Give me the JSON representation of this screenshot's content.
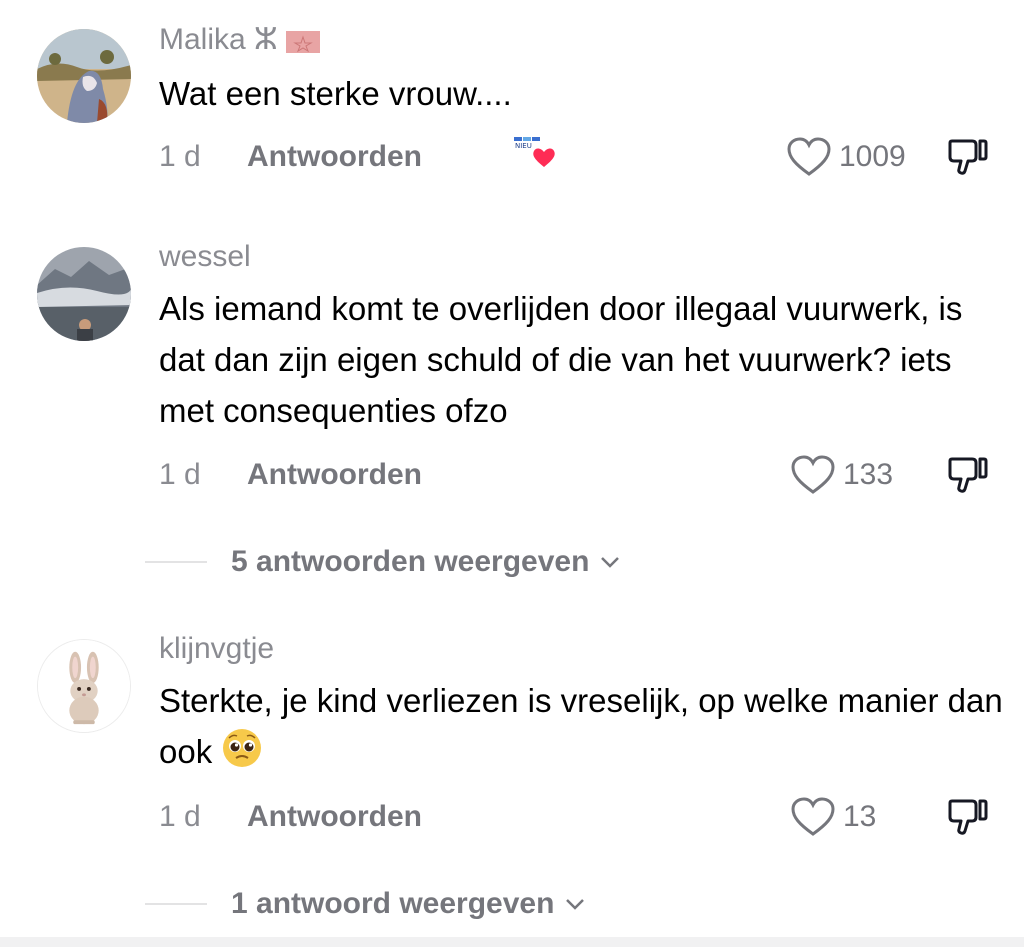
{
  "comments": [
    {
      "username": "Malika ⵣ",
      "text": "Wat een sterke vrouw....",
      "time": "1 d",
      "reply_label": "Antwoorden",
      "like_count": "1009",
      "creator_badge": "NIEU"
    },
    {
      "username": "wessel",
      "text": "Als iemand komt te overlijden door illegaal vuurwerk, is dat dan zijn eigen schuld of die van het vuurwerk? iets met consequenties ofzo",
      "time": "1 d",
      "reply_label": "Antwoorden",
      "like_count": "133",
      "view_replies": "5 antwoorden weergeven"
    },
    {
      "username": "klijnvgtje",
      "text": "Sterkte, je kind verliezen is vreselijk, op welke manier dan ook",
      "time": "1 d",
      "reply_label": "Antwoorden",
      "like_count": "13",
      "view_replies": "1 antwoord weergeven"
    }
  ],
  "colors": {
    "username": "#8a8b91",
    "text": "#000000",
    "muted": "#75767c",
    "heart": "#fe2c55"
  },
  "icons": [
    "heart-outline-icon",
    "dislike-icon",
    "chevron-down-icon",
    "pleading-face-emoji",
    "creator-liked-heart-icon",
    "morocco-flag-icon"
  ]
}
